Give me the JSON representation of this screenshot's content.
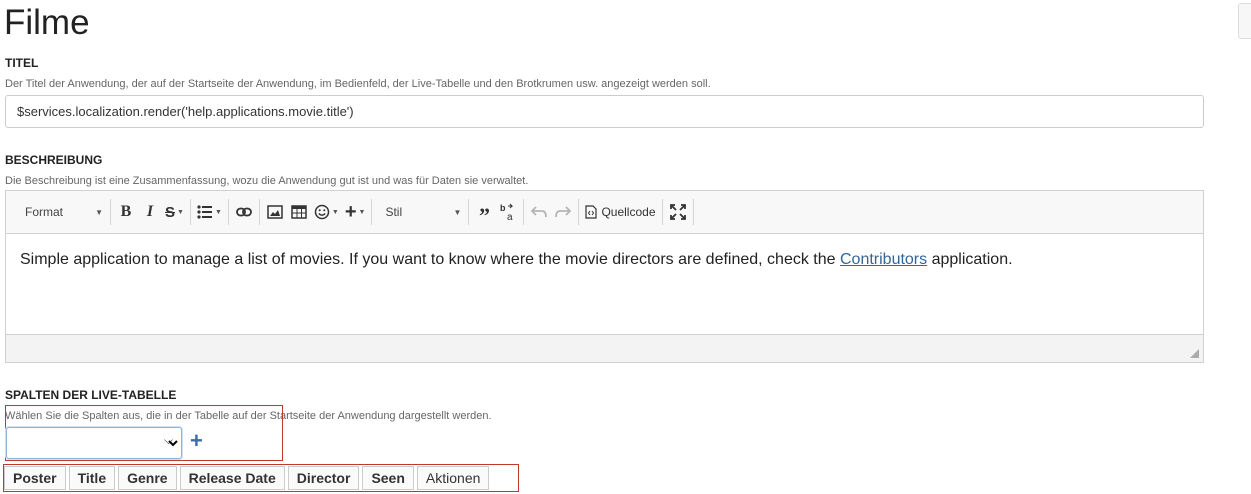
{
  "page": {
    "title": "Filme"
  },
  "title_section": {
    "label": "TITEL",
    "help": "Der Titel der Anwendung, der auf der Startseite der Anwendung, im Bedienfeld, der Live-Tabelle und den Brotkrumen usw. angezeigt werden soll.",
    "value": "$services.localization.render('help.applications.movie.title')"
  },
  "description_section": {
    "label": "BESCHREIBUNG",
    "help": "Die Beschreibung ist eine Zusammenfassung, wozu die Anwendung gut ist und was für Daten sie verwaltet.",
    "toolbar": {
      "format_label": "Format",
      "style_label": "Stil",
      "source_label": "Quellcode"
    },
    "content": {
      "text_before": "Simple application to manage a list of movies. If you want to know where the movie directors are defined, check the ",
      "link_text": "Contributors",
      "text_after": " application."
    }
  },
  "columns_section": {
    "label": "SPALTEN DER LIVE-TABELLE",
    "help": "Wählen Sie die Spalten aus, die in der Tabelle auf der Startseite der Anwendung dargestellt werden.",
    "select_value": "",
    "add_symbol": "+",
    "columns": [
      "Poster",
      "Title",
      "Genre",
      "Release Date",
      "Director",
      "Seen"
    ],
    "actions_column": "Aktionen"
  },
  "icons": {
    "bold": "bold-icon",
    "italic": "italic-icon",
    "strike": "strikethrough-icon",
    "list": "bulleted-list-icon",
    "link": "link-icon",
    "image": "image-icon",
    "table": "table-icon",
    "emoji": "emoji-icon",
    "insert": "plus-icon",
    "quote": "blockquote-icon",
    "spell": "spellcheck-icon",
    "undo": "undo-icon",
    "redo": "redo-icon",
    "source": "source-code-icon",
    "maximize": "maximize-icon"
  },
  "colors": {
    "highlight": "#c0392b",
    "link": "#336699",
    "accent": "#3b6ea8"
  }
}
